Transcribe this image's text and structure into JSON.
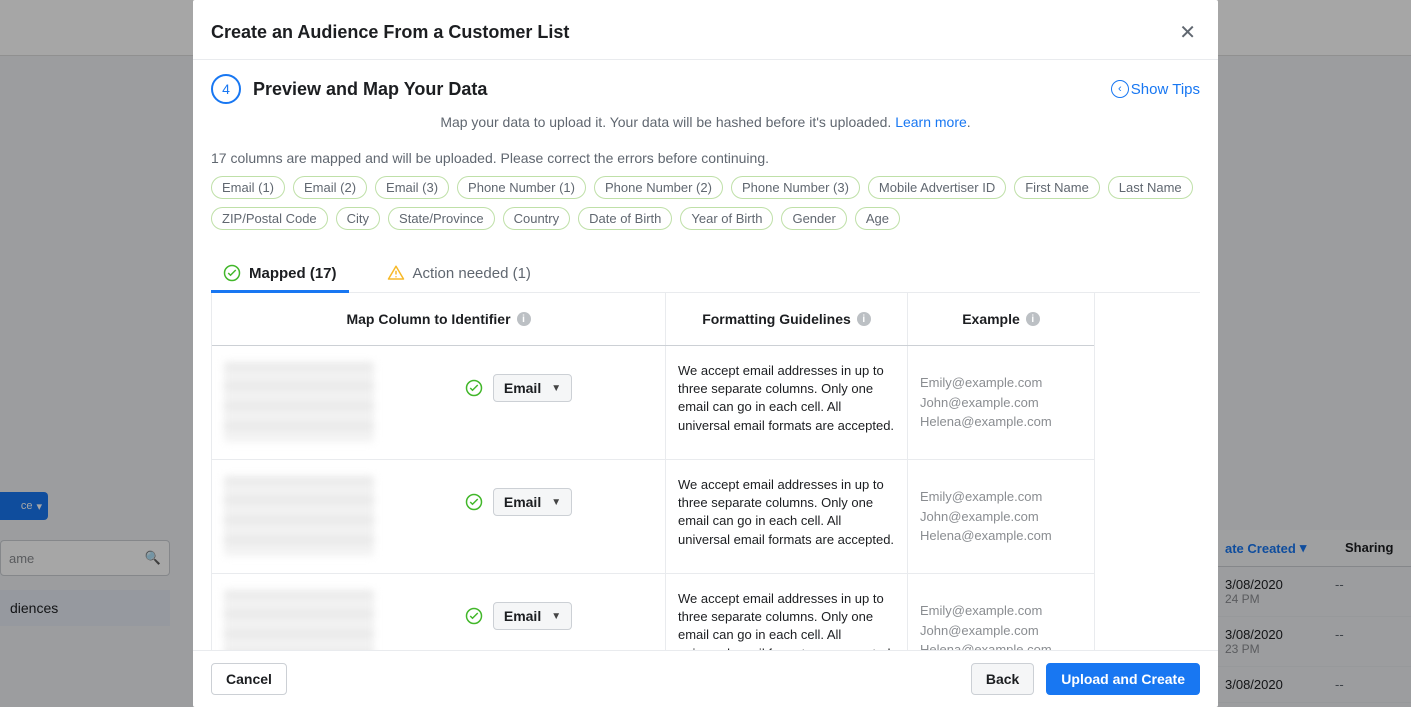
{
  "modal": {
    "title": "Create an Audience From a Customer List",
    "step": {
      "number": "4",
      "title": "Preview and Map Your Data"
    },
    "showTips": "Show Tips",
    "subtext": {
      "prefix": "Map your data to upload it. Your data will be hashed before it's uploaded. ",
      "linkText": "Learn more",
      "suffix": "."
    },
    "summary": "17 columns are mapped and will be uploaded. Please correct the errors before continuing.",
    "pills": [
      "Email (1)",
      "Email (2)",
      "Email (3)",
      "Phone Number (1)",
      "Phone Number (2)",
      "Phone Number (3)",
      "Mobile Advertiser ID",
      "First Name",
      "Last Name",
      "ZIP/Postal Code",
      "City",
      "State/Province",
      "Country",
      "Date of Birth",
      "Year of Birth",
      "Gender",
      "Age"
    ],
    "tabs": {
      "mapped": "Mapped (17)",
      "action": "Action needed (1)"
    },
    "tableHeaders": {
      "map": "Map Column to Identifier",
      "guide": "Formatting Guidelines",
      "example": "Example"
    },
    "guidelineText": "We accept email addresses in up to three separate columns. Only one email can go in each cell. All universal email formats are accepted.",
    "exampleEmails": [
      "Emily@example.com",
      "John@example.com",
      "Helena@example.com"
    ],
    "dropdownLabel": "Email",
    "footer": {
      "cancel": "Cancel",
      "back": "Back",
      "upload": "Upload and Create"
    }
  },
  "background": {
    "searchPlaceholder": "ame",
    "blueBtnSuffix": "ce",
    "sidebarItem": "diences",
    "table": {
      "dateHeader": "ate Created",
      "sharingHeader": "Sharing",
      "rows": [
        {
          "date": "3/08/2020",
          "time": "24 PM",
          "share": "--"
        },
        {
          "date": "3/08/2020",
          "time": "23 PM",
          "share": "--"
        },
        {
          "date": "3/08/2020",
          "time": "",
          "share": "--"
        }
      ]
    }
  }
}
